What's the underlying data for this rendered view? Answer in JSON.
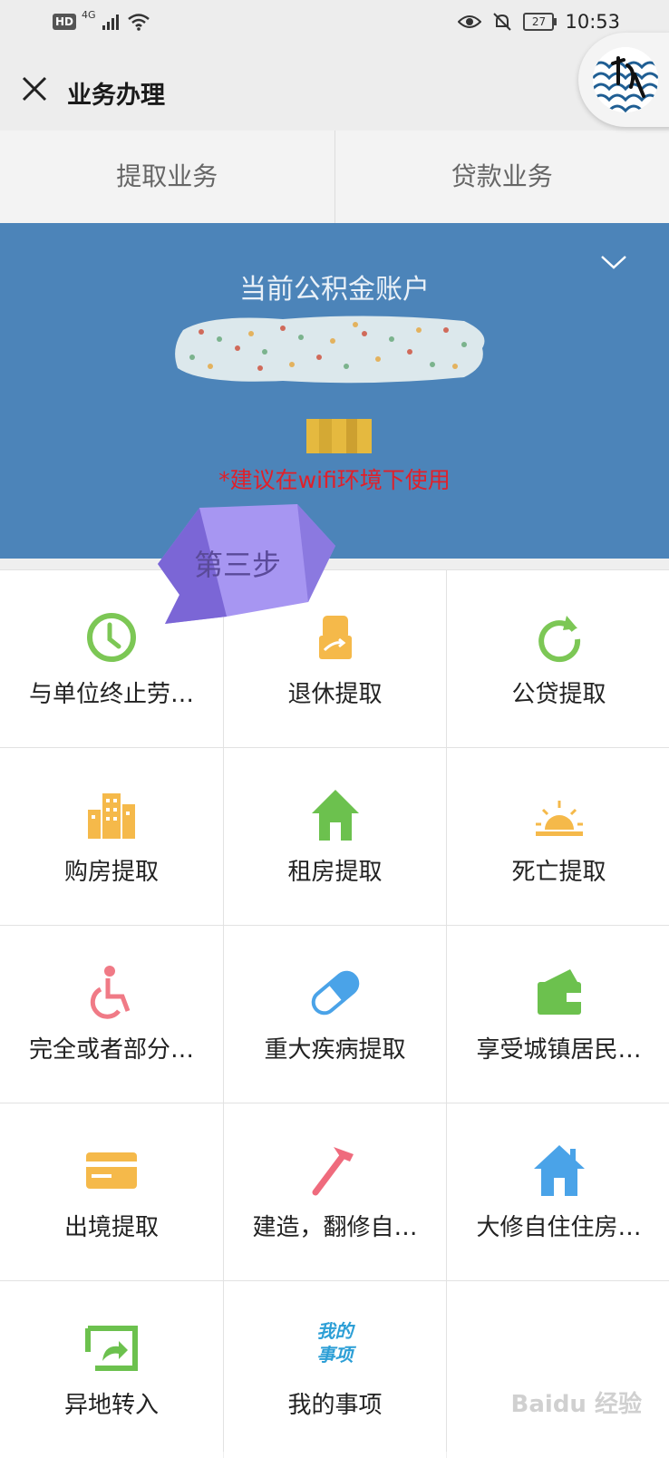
{
  "status_bar": {
    "hd": "HD",
    "network": "4G",
    "battery": "27",
    "time": "10:53"
  },
  "header": {
    "title": "业务办理"
  },
  "tabs": [
    {
      "label": "提取业务"
    },
    {
      "label": "贷款业务"
    }
  ],
  "account": {
    "label": "当前公积金账户",
    "tip": "*建议在wifi环境下使用"
  },
  "callout": {
    "text": "第三步"
  },
  "grid": {
    "items": [
      {
        "label": "与单位终止劳…",
        "icon": "clock-icon",
        "color": "#7cc755"
      },
      {
        "label": "退休提取",
        "icon": "hand-card-icon",
        "color": "#f5b94a"
      },
      {
        "label": "公贷提取",
        "icon": "refresh-icon",
        "color": "#7cc755"
      },
      {
        "label": "购房提取",
        "icon": "buildings-icon",
        "color": "#f5b94a"
      },
      {
        "label": "租房提取",
        "icon": "house-icon",
        "color": "#6cc14e"
      },
      {
        "label": "死亡提取",
        "icon": "sunset-icon",
        "color": "#f5b94a"
      },
      {
        "label": "完全或者部分…",
        "icon": "wheelchair-icon",
        "color": "#f07a86"
      },
      {
        "label": "重大疾病提取",
        "icon": "pill-icon",
        "color": "#4aa3e8"
      },
      {
        "label": "享受城镇居民…",
        "icon": "wallet-icon",
        "color": "#6cc14e"
      },
      {
        "label": "出境提取",
        "icon": "card-icon",
        "color": "#f5b94a"
      },
      {
        "label": "建造，翻修自…",
        "icon": "hammer-icon",
        "color": "#ef6b7d"
      },
      {
        "label": "大修自住住房…",
        "icon": "home-icon",
        "color": "#4aa3e8"
      },
      {
        "label": "异地转入",
        "icon": "transfer-icon",
        "color": "#6cc14e"
      },
      {
        "label": "我的事项",
        "icon": "my-items-icon",
        "color": "#2d9fd6",
        "icon_text_1": "我的",
        "icon_text_2": "事项"
      }
    ]
  },
  "watermark": "Baidu 经验"
}
